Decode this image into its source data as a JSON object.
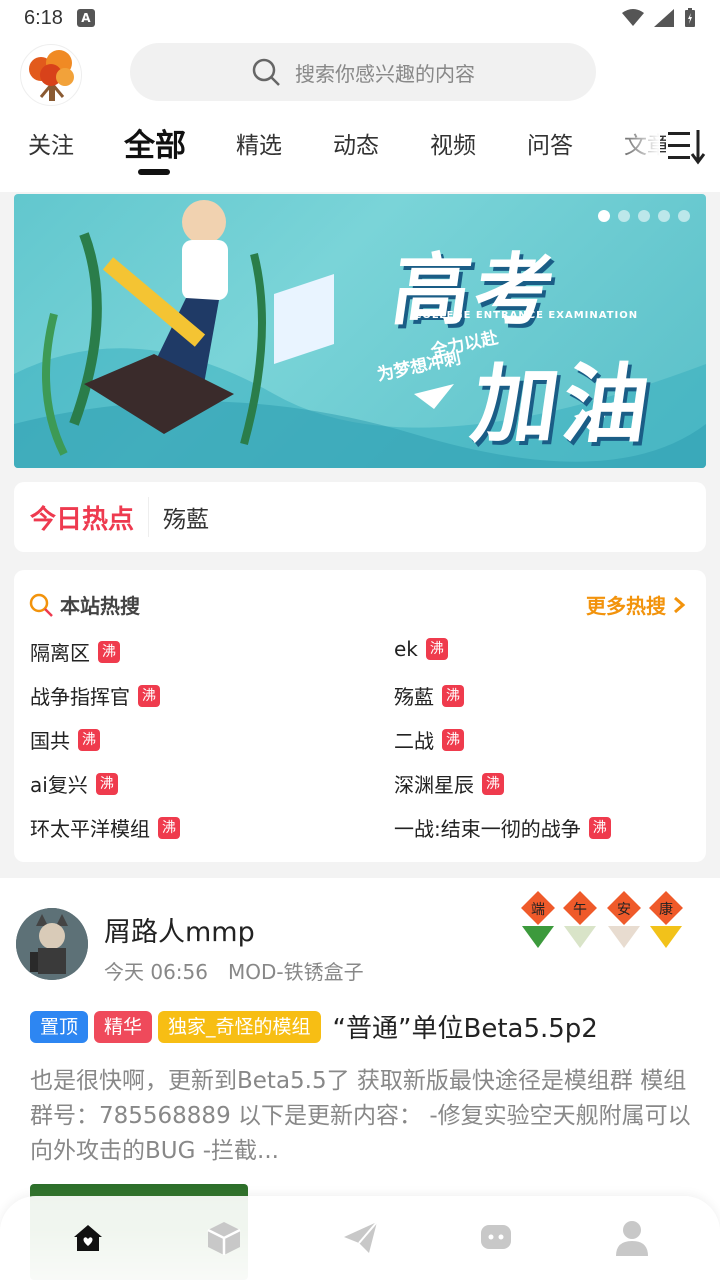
{
  "status_bar": {
    "time": "6:18",
    "app_icon": "A"
  },
  "search": {
    "placeholder": "搜索你感兴趣的内容"
  },
  "tabs": [
    "关注",
    "全部",
    "精选",
    "动态",
    "视频",
    "问答",
    "文章"
  ],
  "active_tab": "全部",
  "banner": {
    "title_line1": "高考",
    "title_line2": "加油",
    "subtitle_en": "COLLEGE ENTRANCE EXAMINATION",
    "subtitle_cn1": "全力以赴",
    "subtitle_cn2": "为梦想冲刺",
    "dot_count": 5,
    "active_dot": 1
  },
  "today_hot": {
    "label": "今日热点",
    "value": "殇藍"
  },
  "hot_search": {
    "title": "本站热搜",
    "more": "更多热搜",
    "badge": "沸",
    "items_left": [
      "隔离区",
      "战争指挥官",
      "国共",
      "ai复兴",
      "环太平洋模组"
    ],
    "items_right": [
      "ek",
      "殇藍",
      "二战",
      "深渊星辰",
      "一战:结束一彻的战争"
    ]
  },
  "post": {
    "username": "屑路人mmp",
    "time": "今天 06:56",
    "category": "MOD-铁锈盒子",
    "tags": [
      "置顶",
      "精华",
      "独家_奇怪的模组"
    ],
    "title": "“普通”单位Beta5.5p2",
    "excerpt": "也是很快啊，更新到Beta5.5了 获取新版最快途径是模组群 模组群号：785568889 以下是更新内容： -修复实验空天舰附属可以向外攻击的BUG -拦截..."
  },
  "bottom_nav": [
    "home-icon",
    "cube-icon",
    "send-icon",
    "chat-icon",
    "user-icon"
  ],
  "colors": {
    "accent_red": "#ee3a4f",
    "accent_orange": "#f2930c",
    "tag_blue": "#2d86f2",
    "tag_red": "#ef4a5b",
    "tag_yellow": "#f7be14"
  }
}
